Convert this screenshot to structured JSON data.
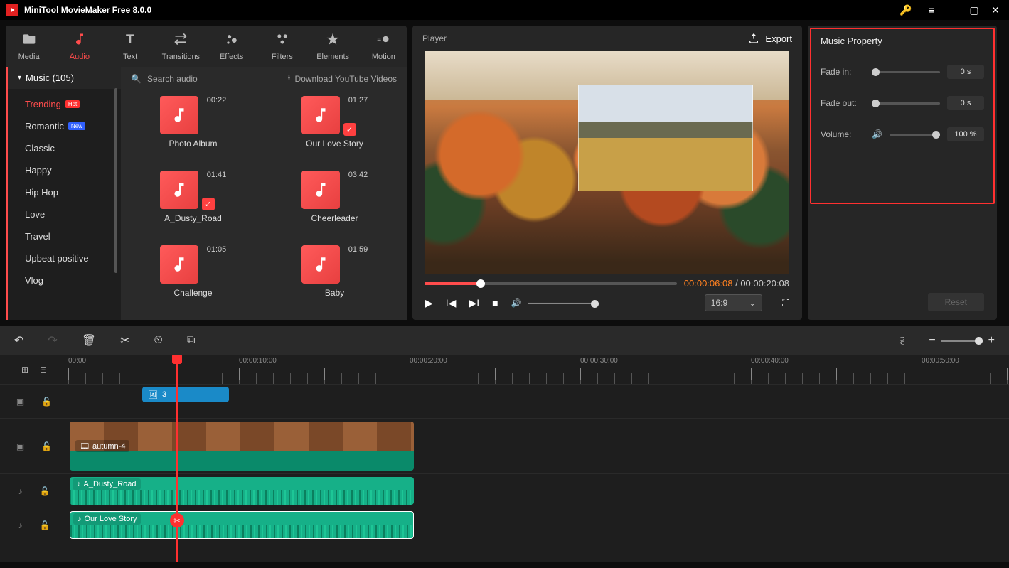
{
  "app": {
    "title": "MiniTool MovieMaker Free 8.0.0"
  },
  "tabs": [
    {
      "label": "Media",
      "glyph": "folder"
    },
    {
      "label": "Audio",
      "glyph": "music",
      "active": true
    },
    {
      "label": "Text",
      "glyph": "text"
    },
    {
      "label": "Transitions",
      "glyph": "swap"
    },
    {
      "label": "Effects",
      "glyph": "sparkle"
    },
    {
      "label": "Filters",
      "glyph": "filter-dots"
    },
    {
      "label": "Elements",
      "glyph": "star"
    },
    {
      "label": "Motion",
      "glyph": "motion"
    }
  ],
  "sidebar": {
    "header": "Music (105)",
    "items": [
      {
        "label": "Trending",
        "badge": "Hot",
        "badgeClass": "hot",
        "active": true
      },
      {
        "label": "Romantic",
        "badge": "New",
        "badgeClass": "new"
      },
      {
        "label": "Classic"
      },
      {
        "label": "Happy"
      },
      {
        "label": "Hip Hop"
      },
      {
        "label": "Love"
      },
      {
        "label": "Travel"
      },
      {
        "label": "Upbeat positive"
      },
      {
        "label": "Vlog"
      }
    ]
  },
  "search": {
    "placeholder": "Search audio",
    "dl": "Download YouTube Videos"
  },
  "audio_items": [
    {
      "name": "Photo Album",
      "dur": "00:22"
    },
    {
      "name": "Our Love Story",
      "dur": "01:27",
      "checked": true
    },
    {
      "name": "A_Dusty_Road",
      "dur": "01:41",
      "checked": true
    },
    {
      "name": "Cheerleader",
      "dur": "03:42"
    },
    {
      "name": "Challenge",
      "dur": "01:05"
    },
    {
      "name": "Baby",
      "dur": "01:59"
    }
  ],
  "player": {
    "title": "Player",
    "export": "Export",
    "time_cur": "00:00:06:08",
    "time_sep": " / ",
    "time_tot": "00:00:20:08",
    "ratio": "16:9"
  },
  "props": {
    "title": "Music Property",
    "fade_in_lbl": "Fade in:",
    "fade_in_val": "0 s",
    "fade_out_lbl": "Fade out:",
    "fade_out_val": "0 s",
    "volume_lbl": "Volume:",
    "volume_val": "100 %",
    "reset": "Reset"
  },
  "timeline": {
    "ruler": [
      "00:00",
      "00:00:10:00",
      "00:00:20:00",
      "00:00:30:00",
      "00:00:40:00",
      "00:00:50:00"
    ],
    "pip": {
      "label": "3"
    },
    "video": {
      "label": "autumn-4"
    },
    "audio1": {
      "label": "A_Dusty_Road"
    },
    "audio2": {
      "label": "Our Love Story"
    }
  }
}
